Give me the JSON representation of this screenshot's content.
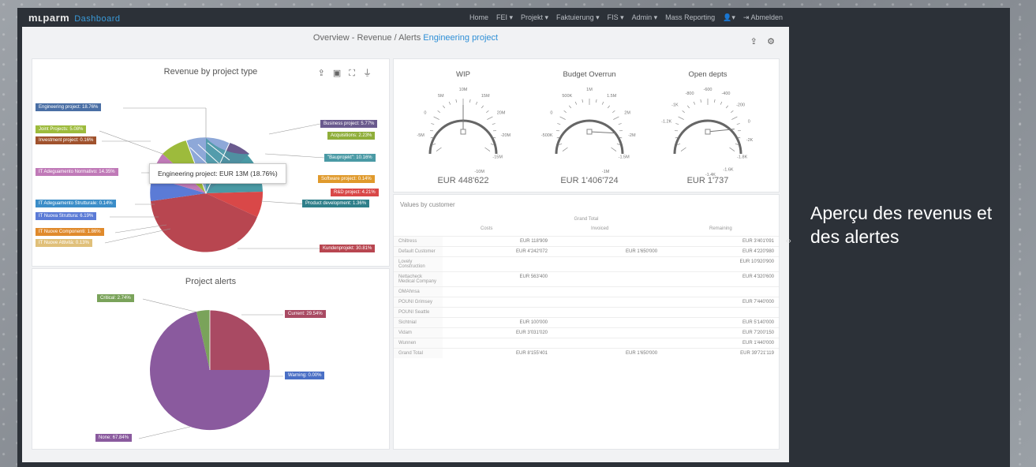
{
  "app": {
    "logo": "mʟparm",
    "logo_sub": "Dashboard"
  },
  "nav": [
    "Home",
    "FEI ▾",
    "Projekt ▾",
    "Faktuierung ▾",
    "FIS ▾",
    "Admin ▾",
    "Mass Reporting",
    "👤▾",
    "⇥ Abmelden"
  ],
  "breadcrumb": {
    "base": "Overview - Revenue / Alerts",
    "link": "Engineering project"
  },
  "revenue_card": {
    "title": "Revenue by project type",
    "tooltip": "Engineering project: EUR 13M (18.76%)",
    "labels_left": [
      {
        "text": "Engineering project: 18.76%",
        "color": "#4a6fa5"
      },
      {
        "text": "Joint Projects: 5.08%",
        "color": "#9dbb3c"
      },
      {
        "text": "Investment project: 0.16%",
        "color": "#a0522d"
      },
      {
        "text": "IT Adeguamento Normativo: 14.35%",
        "color": "#c07ab8"
      },
      {
        "text": "IT Adeguamento Strutturale: 0.14%",
        "color": "#3b8dc8"
      },
      {
        "text": "IT Nuova Struttura: 6.19%",
        "color": "#5b7bd6"
      },
      {
        "text": "IT Nuove Componenti: 1.86%",
        "color": "#e08a2c"
      },
      {
        "text": "IT Nuove Attività: 0.13%",
        "color": "#e0c07a"
      }
    ],
    "labels_right": [
      {
        "text": "Business project: 5.77%",
        "color": "#6a5a8e"
      },
      {
        "text": "Acquisitions: 2.23%",
        "color": "#8fae3a"
      },
      {
        "text": "\"Bauprojekt\": 10.16%",
        "color": "#4a9aa5"
      },
      {
        "text": "Software project: 0.14%",
        "color": "#e09a2c"
      },
      {
        "text": "R&D project: 4.21%",
        "color": "#d94848"
      },
      {
        "text": "Product development: 1.36%",
        "color": "#2f7f8a"
      },
      {
        "text": "Kundenprojekt: 30.81%",
        "color": "#b84650"
      }
    ]
  },
  "alerts_card": {
    "title": "Project alerts",
    "labels": [
      {
        "text": "Critical: 2.74%",
        "color": "#7aa35a"
      },
      {
        "text": "Current: 29.54%",
        "color": "#a94a63"
      },
      {
        "text": "Warning: 0.00%",
        "color": "#4a6fc5"
      },
      {
        "text": "None: 67.84%",
        "color": "#8a5a9e"
      }
    ]
  },
  "gauges": [
    {
      "title": "WIP",
      "value": "EUR 448'622",
      "ticks": [
        "-5M",
        "0",
        "5M",
        "10M",
        "15M",
        "20M",
        "-20M",
        "-15M",
        "-10M"
      ]
    },
    {
      "title": "Budget Overrun",
      "value": "EUR 1'406'724",
      "ticks": [
        "-500K",
        "0",
        "500K",
        "1M",
        "1.5M",
        "2M",
        "-2M",
        "-1.5M",
        "-1M"
      ]
    },
    {
      "title": "Open depts",
      "value": "EUR 1'737",
      "ticks": [
        "-1.2K",
        "-1K",
        "-800",
        "-600",
        "-400",
        "-200",
        "0",
        "-2K",
        "-1.8K",
        "-1.6K",
        "-1.4K"
      ]
    }
  ],
  "values_table": {
    "title": "Values by customer",
    "group_header": "Grand Total",
    "col_headers": [
      "Costs",
      "Invoiced",
      "Remaining"
    ],
    "rows": [
      {
        "name": "Chiltress",
        "costs": "EUR 118'909",
        "invoiced": "",
        "remaining": "EUR 3'401'091"
      },
      {
        "name": "Default Customer",
        "costs": "EUR 4'242'072",
        "invoiced": "EUR 1'650'000",
        "remaining": "EUR 4'220'980"
      },
      {
        "name": "Lovely Construction",
        "costs": "",
        "invoiced": "",
        "remaining": "EUR 10'920'900"
      },
      {
        "name": "Nettacheck Medical Company",
        "costs": "EUR 563'400",
        "invoiced": "",
        "remaining": "EUR 4'320'600"
      },
      {
        "name": "OMAhnsa",
        "costs": "",
        "invoiced": "",
        "remaining": ""
      },
      {
        "name": "POUNI Grimsey",
        "costs": "",
        "invoiced": "",
        "remaining": "EUR 7'440'000"
      },
      {
        "name": "POUNI Seattle",
        "costs": "",
        "invoiced": "",
        "remaining": ""
      },
      {
        "name": "Sichtnial",
        "costs": "EUR 100'000",
        "invoiced": "",
        "remaining": "EUR 5'140'000"
      },
      {
        "name": "Vidam",
        "costs": "EUR 3'031'020",
        "invoiced": "",
        "remaining": "EUR 7'200'150"
      },
      {
        "name": "Wunnen",
        "costs": "",
        "invoiced": "",
        "remaining": "EUR 1'440'000"
      },
      {
        "name": "Grand Total",
        "costs": "EUR 8'155'401",
        "invoiced": "EUR 1'650'000",
        "remaining": "EUR 39'721'119"
      }
    ]
  },
  "side_caption": "Aperçu des revenus et des alertes"
}
